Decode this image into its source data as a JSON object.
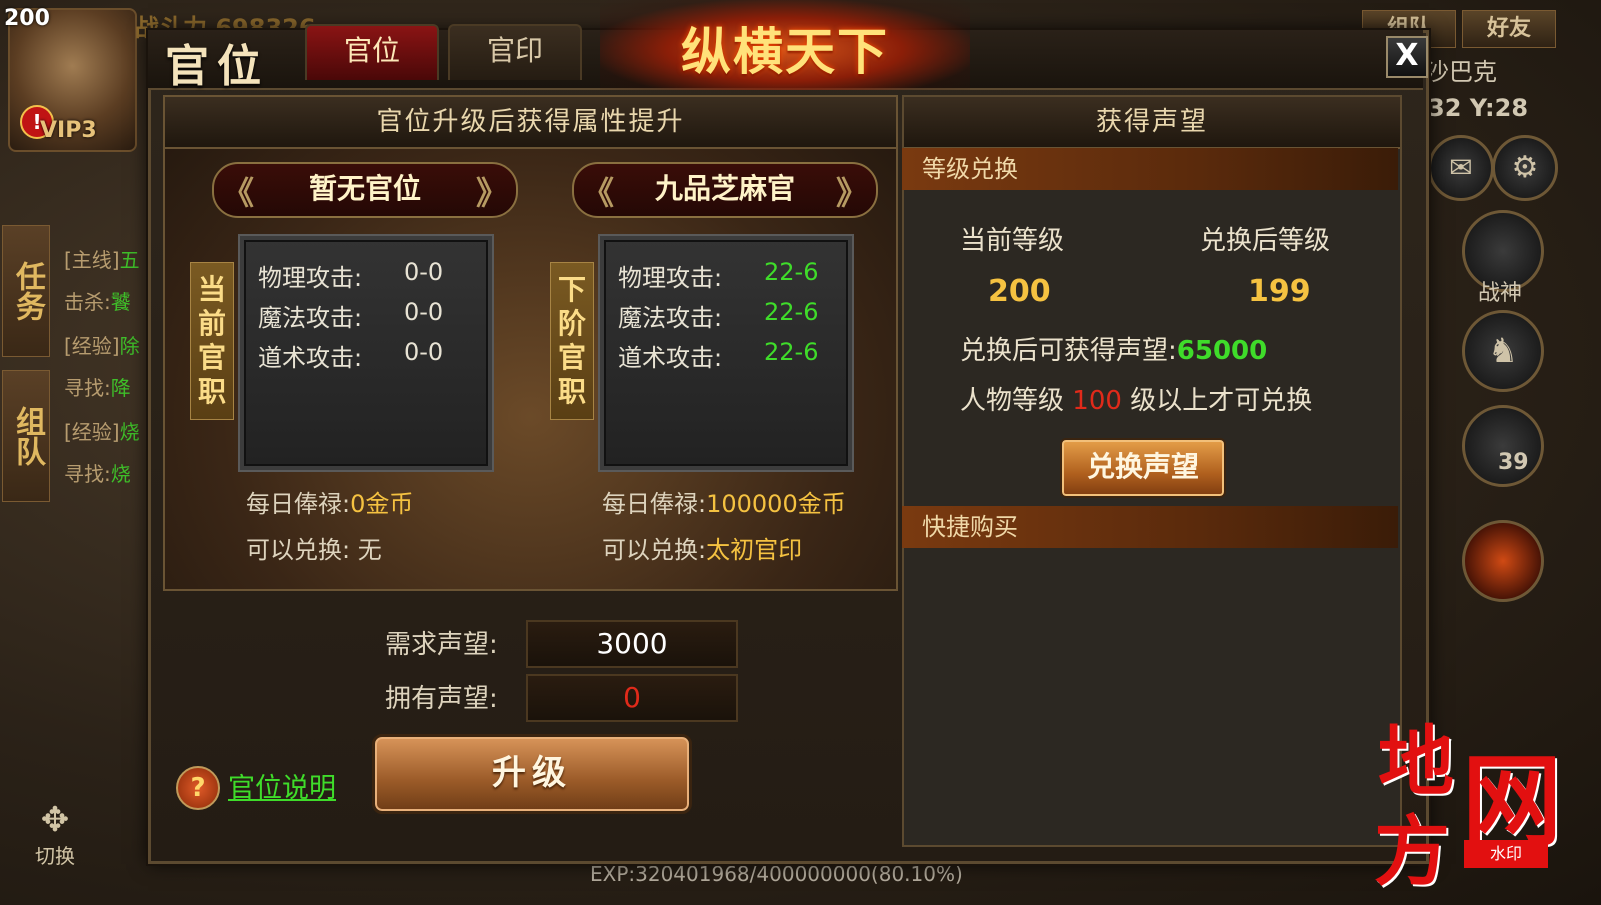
{
  "hud": {
    "level": "200",
    "vip": "VIP3",
    "alert": "!",
    "power": "战斗力 698326",
    "side_tabs": [
      "任务",
      "组队"
    ],
    "tasks": [
      {
        "tag": "[主线]",
        "text": "五"
      },
      {
        "tag": "击杀:",
        "text": "饕"
      },
      {
        "tag": "[经验]",
        "text": "除"
      },
      {
        "tag": "寻找:",
        "text": "降"
      },
      {
        "tag": "[经验]",
        "text": "烧"
      },
      {
        "tag": "寻找:",
        "text": "烧"
      }
    ],
    "team_btn": "组队",
    "friend_btn": "好友",
    "player_name": "沙巴克",
    "coords": "32 Y:28",
    "battle_god": "战神",
    "badge_count": "39",
    "switch_label": "切换",
    "exp_text": "EXP:320401968/400000000(80.10%)"
  },
  "window": {
    "title": "官位",
    "tabs": [
      "官位",
      "官印"
    ],
    "banner": "纵横天下",
    "close": "X"
  },
  "left": {
    "header": "官位升级后获得属性提升",
    "current": {
      "rank": "暂无官位",
      "label": "当前官职",
      "stats": [
        {
          "name": "物理攻击:",
          "value": "0-0"
        },
        {
          "name": "魔法攻击:",
          "value": "0-0"
        },
        {
          "name": "道术攻击:",
          "value": "0-0"
        }
      ],
      "salary_label": "每日俸禄:",
      "salary_value": "0金币",
      "exchange_label": "可以兑换:",
      "exchange_value": "无"
    },
    "next": {
      "rank": "九品芝麻官",
      "label": "下阶官职",
      "stats": [
        {
          "name": "物理攻击:",
          "value": "22-6"
        },
        {
          "name": "魔法攻击:",
          "value": "22-6"
        },
        {
          "name": "道术攻击:",
          "value": "22-6"
        }
      ],
      "salary_label": "每日俸禄:",
      "salary_value": "100000金币",
      "exchange_label": "可以兑换:",
      "exchange_value": "太初官印"
    },
    "required_label": "需求声望:",
    "required_value": "3000",
    "owned_label": "拥有声望:",
    "owned_value": "0",
    "upgrade_button": "升级",
    "help_icon": "?",
    "help_link": "官位说明"
  },
  "right": {
    "header": "获得声望",
    "section_exchange": "等级兑换",
    "current_level_label": "当前等级",
    "after_level_label": "兑换后等级",
    "current_level": "200",
    "after_level": "199",
    "gain_label": "兑换后可获得声望:",
    "gain_value": "65000",
    "req_prefix": "人物等级",
    "req_level": "100",
    "req_suffix": "级以上才可兑换",
    "exchange_button": "兑换声望",
    "section_buy": "快捷购买"
  },
  "watermark": {
    "chars": [
      "地",
      "方",
      "网"
    ],
    "stamp": "水印"
  },
  "colors": {
    "gold": "#f5c241",
    "green": "#3fdc2a",
    "red": "#e02a1a",
    "section_bar": "#7a3a10"
  }
}
